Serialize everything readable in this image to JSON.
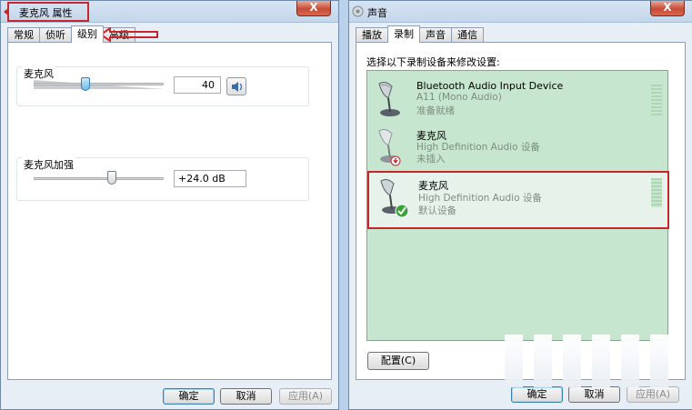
{
  "left_window": {
    "title": "麦克风 属性",
    "close_label": "X",
    "tabs": [
      "常规",
      "侦听",
      "级别",
      "高级"
    ],
    "active_tab": "级别",
    "mic_group": {
      "label": "麦克风",
      "value": "40",
      "slider_percent": 40,
      "speaker_icon": "speaker-icon"
    },
    "boost_group": {
      "label": "麦克风加强",
      "value": "+24.0 dB",
      "slider_percent": 60
    },
    "buttons": {
      "ok": "确定",
      "cancel": "取消",
      "apply": "应用(A)"
    }
  },
  "right_window": {
    "title": "声音",
    "close_label": "X",
    "tabs": [
      "播放",
      "录制",
      "声音",
      "通信"
    ],
    "active_tab": "录制",
    "instruction": "选择以下录制设备来修改设置:",
    "devices": [
      {
        "name": "Bluetooth Audio Input Device",
        "sub": "A11 (Mono Audio)",
        "status": "准备就绪",
        "icon": "microphone-icon"
      },
      {
        "name": "麦克风",
        "sub": "High Definition Audio 设备",
        "status": "未插入",
        "icon": "microphone-unplugged-icon"
      },
      {
        "name": "麦克风",
        "sub": "High Definition Audio 设备",
        "status": "默认设备",
        "icon": "microphone-default-icon"
      }
    ],
    "buttons": {
      "configure": "配置(C)",
      "ok": "确定",
      "cancel": "取消",
      "apply": "应用(A)"
    }
  },
  "colors": {
    "annotation": "#c8262b",
    "device_list_bg": "#c7e6cf"
  }
}
